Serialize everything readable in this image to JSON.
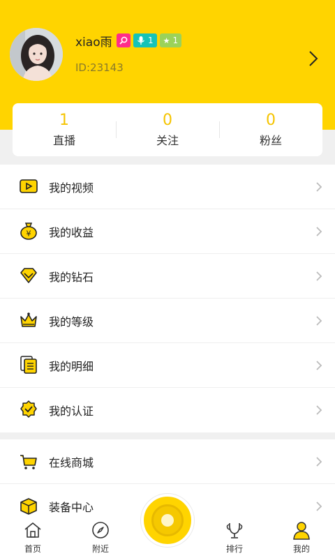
{
  "profile": {
    "username": "xiao雨",
    "id_text": "ID:23143",
    "badges": [
      {
        "icon": "search-badge-icon",
        "text": "",
        "color": "#ff2d8a"
      },
      {
        "icon": "mic-icon",
        "text": "1",
        "color": "#16c3b8"
      },
      {
        "icon": "star-icon",
        "text": "1",
        "color": "#9bd25a"
      }
    ]
  },
  "stats": [
    {
      "value": "1",
      "label": "直播"
    },
    {
      "value": "0",
      "label": "关注"
    },
    {
      "value": "0",
      "label": "粉丝"
    }
  ],
  "menu": [
    {
      "label": "我的视频",
      "icon": "video-icon"
    },
    {
      "label": "我的收益",
      "icon": "money-bag-icon"
    },
    {
      "label": "我的钻石",
      "icon": "diamond-icon"
    },
    {
      "label": "我的等级",
      "icon": "crown-icon"
    },
    {
      "label": "我的明细",
      "icon": "document-list-icon"
    },
    {
      "label": "我的认证",
      "icon": "verified-badge-icon"
    }
  ],
  "menu2": [
    {
      "label": "在线商城",
      "icon": "cart-icon"
    },
    {
      "label": "装备中心",
      "icon": "package-icon"
    }
  ],
  "tabs": [
    {
      "label": "首页",
      "icon": "home-icon"
    },
    {
      "label": "附近",
      "icon": "compass-icon"
    },
    {
      "label": "排行",
      "icon": "trophy-icon"
    },
    {
      "label": "我的",
      "icon": "user-icon"
    }
  ],
  "colors": {
    "accent": "#ffd400",
    "stat_value": "#f5c400"
  }
}
